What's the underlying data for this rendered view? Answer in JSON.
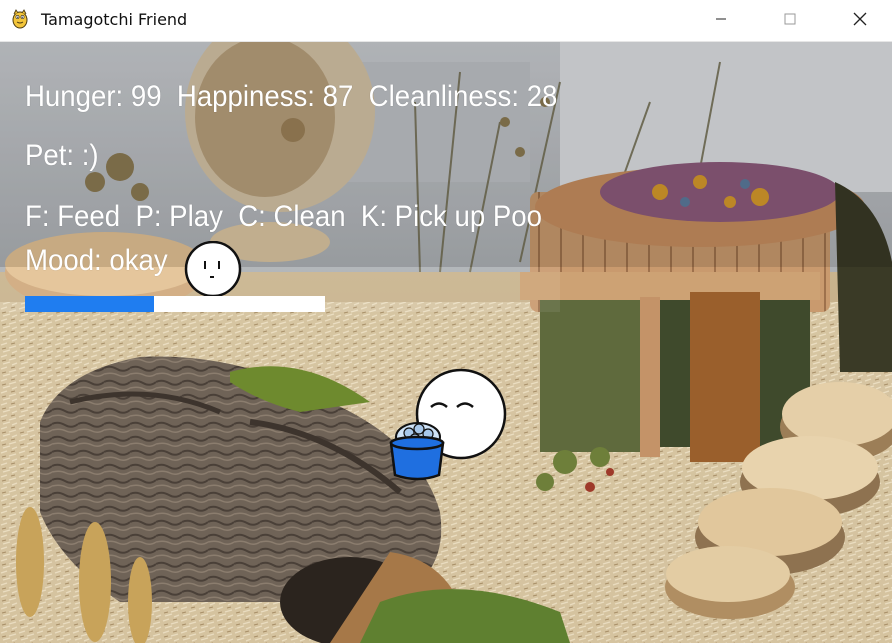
{
  "window": {
    "title": "Tamagotchi Friend",
    "controls": {
      "minimize": "minimize-icon",
      "maximize": "maximize-icon",
      "close": "close-icon"
    }
  },
  "hud": {
    "stats_line": "Hunger: 99  Happiness: 87  Cleanliness: 28",
    "pet_line": "Pet: :)",
    "controls_line": "F: Feed  P: Play  C: Clean  K: Pick up Poo",
    "mood_line": "Mood: okay"
  },
  "mood_progress": 0.43,
  "colors": {
    "progress_fill": "#1f7df0",
    "progress_track": "#ffffff",
    "food_bowl": "#1f6fe0",
    "text": "#ffffff"
  },
  "icons": {
    "app": "pygame-snake-icon",
    "mood_face": "neutral-face-icon",
    "pet": "pet-blob-eating-icon",
    "bowl": "food-bowl-icon"
  }
}
